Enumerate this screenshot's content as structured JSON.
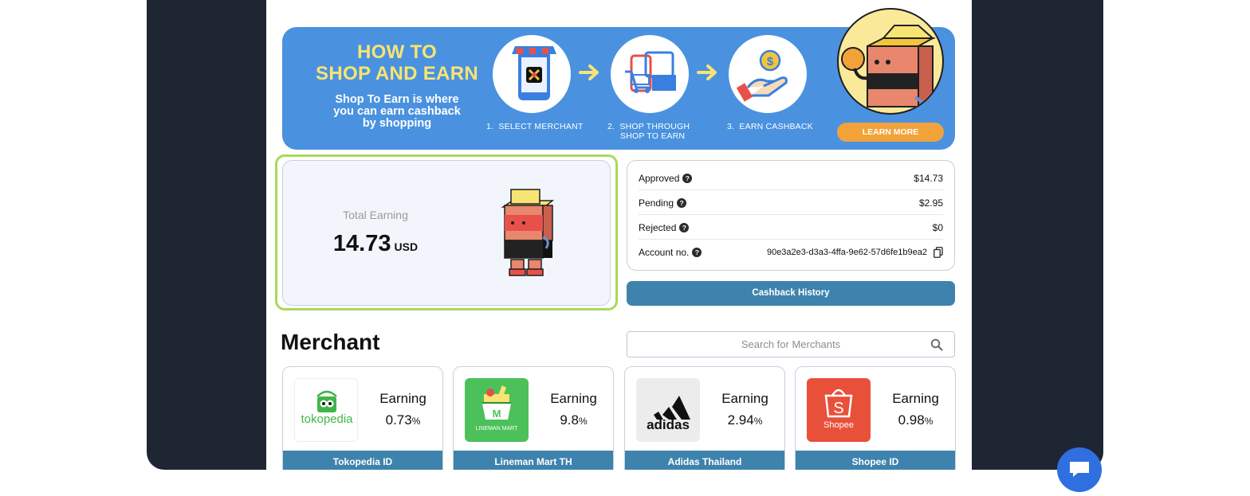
{
  "banner": {
    "title_line1": "HOW TO",
    "title_line2": "SHOP AND EARN",
    "subtitle_line1": "Shop To Earn is where",
    "subtitle_line2": "you can earn cashback",
    "subtitle_line3": "by shopping",
    "steps": [
      {
        "num": "1.",
        "line1": "SELECT MERCHANT",
        "line2": ""
      },
      {
        "num": "2.",
        "line1": "SHOP THROUGH",
        "line2": "SHOP TO EARN"
      },
      {
        "num": "3.",
        "line1": "EARN CASHBACK",
        "line2": ""
      }
    ],
    "learn_more": "LEARN MORE",
    "colors": {
      "background": "#4a92e0",
      "title": "#f8e472",
      "button": "#f1a33a"
    }
  },
  "earning": {
    "label": "Total Earning",
    "value": "14.73",
    "currency": "USD",
    "highlight_color": "#a9d95a"
  },
  "stats": {
    "approved_label": "Approved",
    "approved_value": "$14.73",
    "pending_label": "Pending",
    "pending_value": "$2.95",
    "rejected_label": "Rejected",
    "rejected_value": "$0",
    "account_label": "Account no.",
    "account_value": "90e3a2e3-d3a3-4ffa-9e62-57d6fe1b9ea2",
    "help_icon": "question-circle-icon",
    "copy_icon": "copy-icon"
  },
  "cashback_history": "Cashback History",
  "merchant": {
    "title": "Merchant",
    "search_placeholder": "Search for Merchants",
    "earning_label": "Earning",
    "items": [
      {
        "name": "Tokopedia ID",
        "rate": "0.73",
        "unit": "%",
        "logo_text": "tokopedia"
      },
      {
        "name": "Lineman Mart TH",
        "rate": "9.8",
        "unit": "%",
        "logo_text": "LINEMAN MART"
      },
      {
        "name": "Adidas Thailand",
        "rate": "2.94",
        "unit": "%",
        "logo_text": "adidas"
      },
      {
        "name": "Shopee ID",
        "rate": "0.98",
        "unit": "%",
        "logo_text": "Shopee"
      }
    ]
  },
  "accent_color": "#3e83ad"
}
